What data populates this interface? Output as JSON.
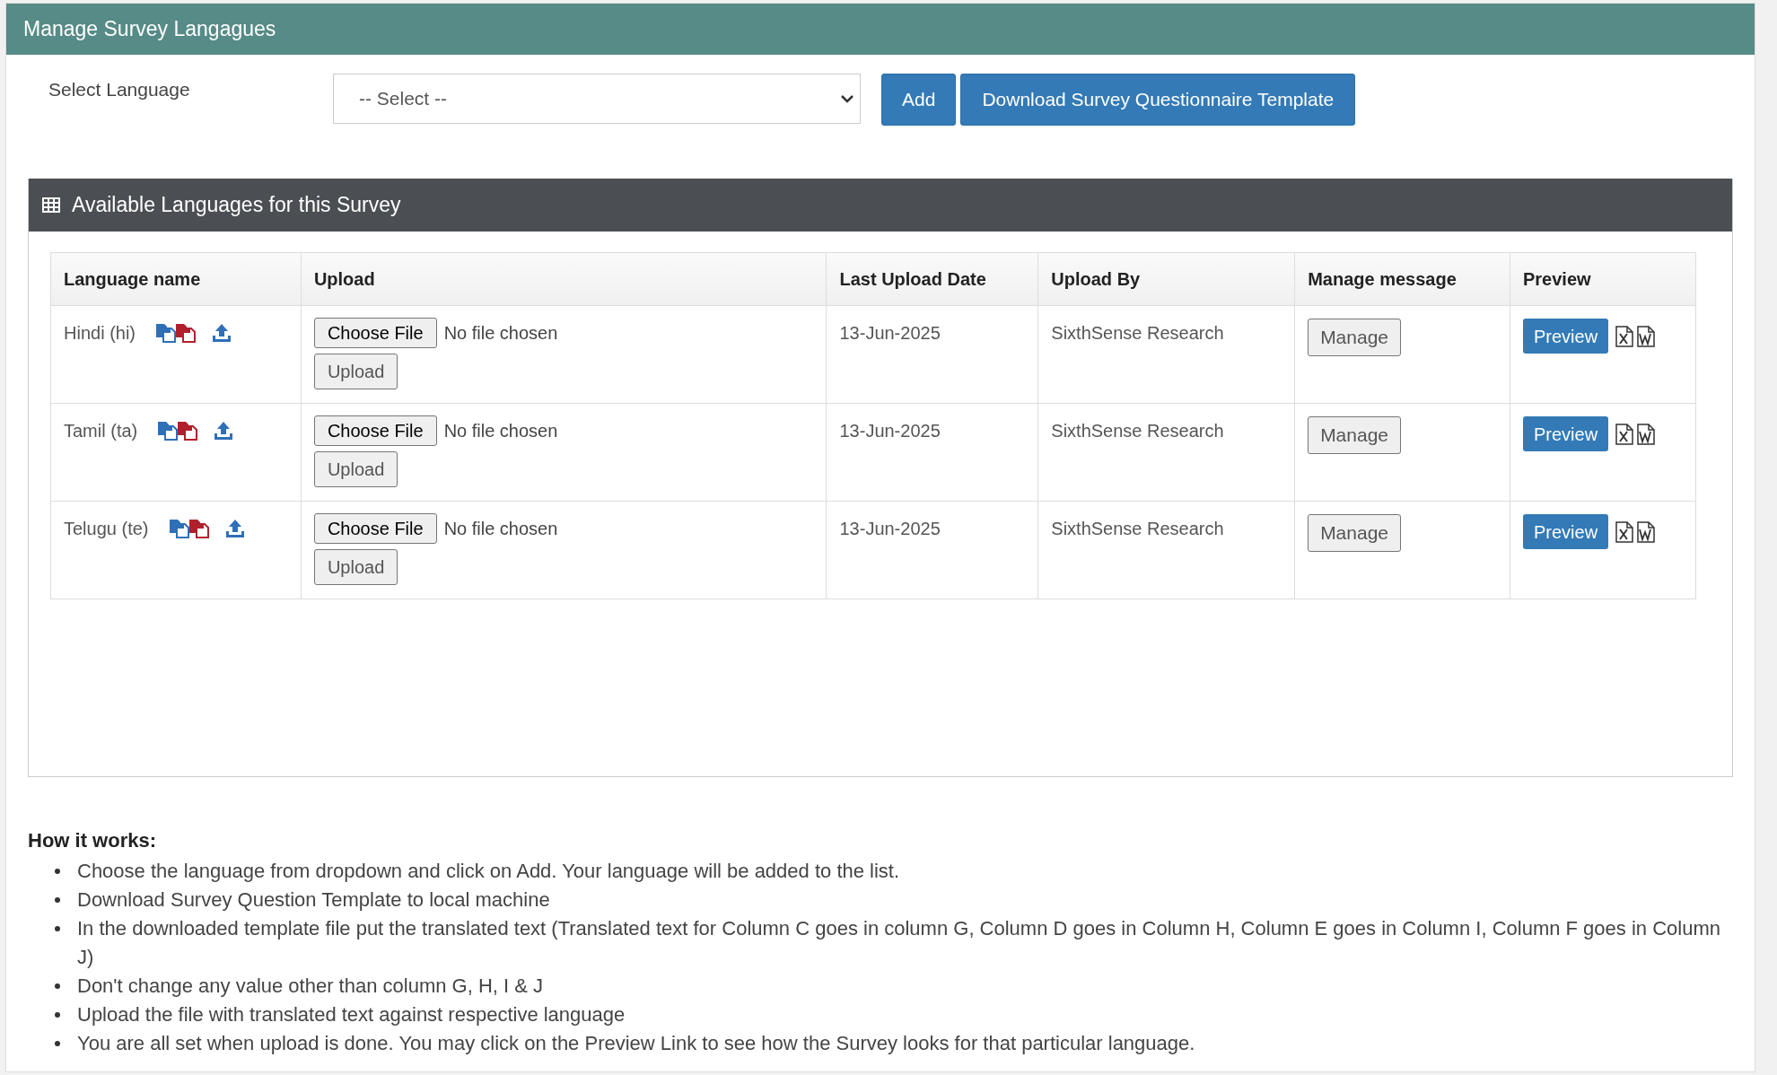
{
  "header": {
    "title": "Manage Survey Langagues"
  },
  "select_language": {
    "label": "Select Language",
    "value": "-- Select --"
  },
  "buttons": [
    "Add",
    "Download Survey Questionnaire Template"
  ],
  "panel": {
    "title": "Available Languages for this Survey"
  },
  "table": {
    "columns": [
      "Language name",
      "Upload",
      "Last Upload Date",
      "Upload By",
      "Manage message",
      "Preview"
    ],
    "rows": [
      {
        "language": "Hindi (hi)",
        "choose_file": "Choose File",
        "file_status": "No file chosen",
        "upload": "Upload",
        "last_upload_date": "13-Jun-2025",
        "upload_by": "SixthSense Research",
        "manage": "Manage",
        "preview": "Preview"
      },
      {
        "language": "Tamil (ta)",
        "choose_file": "Choose File",
        "file_status": "No file chosen",
        "upload": "Upload",
        "last_upload_date": "13-Jun-2025",
        "upload_by": "SixthSense Research",
        "manage": "Manage",
        "preview": "Preview"
      },
      {
        "language": "Telugu (te)",
        "choose_file": "Choose File",
        "file_status": "No file chosen",
        "upload": "Upload",
        "last_upload_date": "13-Jun-2025",
        "upload_by": "SixthSense Research",
        "manage": "Manage",
        "preview": "Preview"
      }
    ]
  },
  "help": {
    "title": "How it works:",
    "items": [
      "Choose the language from dropdown and click on Add. Your language will be added to the list.",
      "Download Survey Question Template to local machine",
      "In the downloaded template file put the translated text (Translated text for Column C goes in column G, Column D goes in Column H, Column E goes in Column I, Column F goes in Column J)",
      "Don't change any value other than column G, H, I & J",
      "Upload the file with translated text against respective language",
      "You are all set when upload is done. You may click on the Preview Link to see how the Survey looks for that particular language."
    ]
  }
}
